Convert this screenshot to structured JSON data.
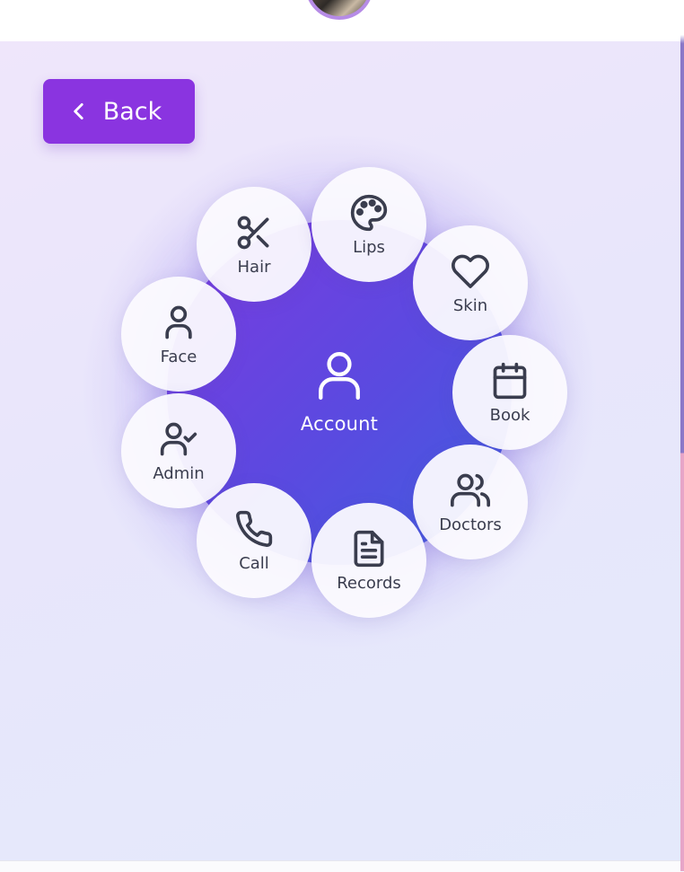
{
  "nav": {
    "back_label": "Back"
  },
  "hub": {
    "label": "Account",
    "icon": "user-icon"
  },
  "nodes": [
    {
      "label": "Hair",
      "icon": "scissors-icon"
    },
    {
      "label": "Lips",
      "icon": "palette-icon"
    },
    {
      "label": "Skin",
      "icon": "heart-icon"
    },
    {
      "label": "Face",
      "icon": "user-icon"
    },
    {
      "label": "Book",
      "icon": "calendar-icon"
    },
    {
      "label": "Admin",
      "icon": "user-check-icon"
    },
    {
      "label": "Doctors",
      "icon": "users-icon"
    },
    {
      "label": "Call",
      "icon": "phone-icon"
    },
    {
      "label": "Records",
      "icon": "file-text-icon"
    }
  ],
  "colors": {
    "accent": "#8a34e0",
    "hub_gradient_start": "#7c3ae0",
    "hub_gradient_end": "#3f5ee0",
    "icon_text": "#3a3d4e"
  }
}
